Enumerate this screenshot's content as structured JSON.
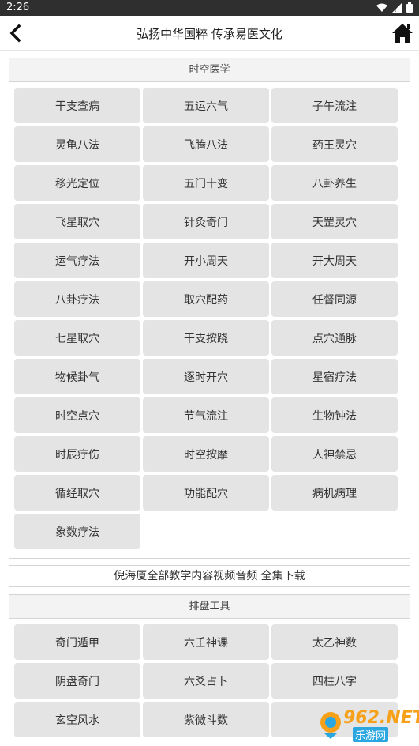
{
  "statusbar": {
    "time": "2:26"
  },
  "appbar": {
    "title": "弘扬中华国粹 传承易医文化"
  },
  "section1": {
    "header": "时空医学",
    "items": [
      "干支查病",
      "五运六气",
      "子午流注",
      "灵龟八法",
      "飞腾八法",
      "药王灵穴",
      "移光定位",
      "五门十变",
      "八卦养生",
      "飞星取穴",
      "针灸奇门",
      "天罡灵穴",
      "运气疗法",
      "开小周天",
      "开大周天",
      "八卦疗法",
      "取穴配药",
      "任督同源",
      "七星取穴",
      "干支按跷",
      "点穴通脉",
      "物候卦气",
      "逐时开穴",
      "星宿疗法",
      "时空点穴",
      "节气流注",
      "生物钟法",
      "时辰疗伤",
      "时空按摩",
      "人神禁忌",
      "循经取穴",
      "功能配穴",
      "病机病理",
      "象数疗法"
    ]
  },
  "banner": {
    "text": "倪海厦全部教学内容视频音频 全集下载"
  },
  "section2": {
    "header": "排盘工具",
    "items": [
      "奇门遁甲",
      "六壬神课",
      "太乙神数",
      "阴盘奇门",
      "六爻占卜",
      "四柱八字",
      "玄空风水",
      "紫微斗数",
      ""
    ]
  },
  "watermark": {
    "num": "962.NET",
    "sub": "乐游网"
  }
}
